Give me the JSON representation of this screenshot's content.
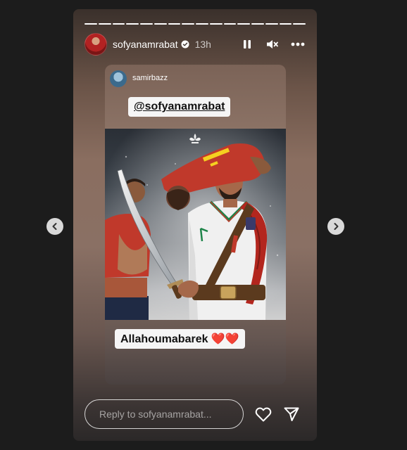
{
  "story": {
    "progress": {
      "total_segments": 16,
      "completed_segments": 16
    },
    "header": {
      "username": "sofyanamrabat",
      "time": "13h",
      "icons": [
        "verified-badge-icon",
        "pause-icon",
        "mute-icon",
        "more-icon"
      ]
    },
    "repost": {
      "username": "samirbazz",
      "mention_sticker": "@sofyanamrabat",
      "text_sticker": "Allahoumabarek ❤️❤️"
    },
    "reply": {
      "placeholder": "Reply to sofyanamrabat...",
      "icons": [
        "heart-icon",
        "send-icon"
      ]
    }
  },
  "navigation": {
    "icons": [
      "chevron-left-icon",
      "chevron-right-icon"
    ]
  },
  "colors": {
    "page_background": "#1c1c1c",
    "sticker_background": "#f5f5f5",
    "jersey_red": "#c0392b",
    "jersey_white": "#f0f0f0",
    "trim_green": "#1e8449",
    "scarf_red": "#b3261e",
    "leather_brown": "#5b3a1e"
  }
}
